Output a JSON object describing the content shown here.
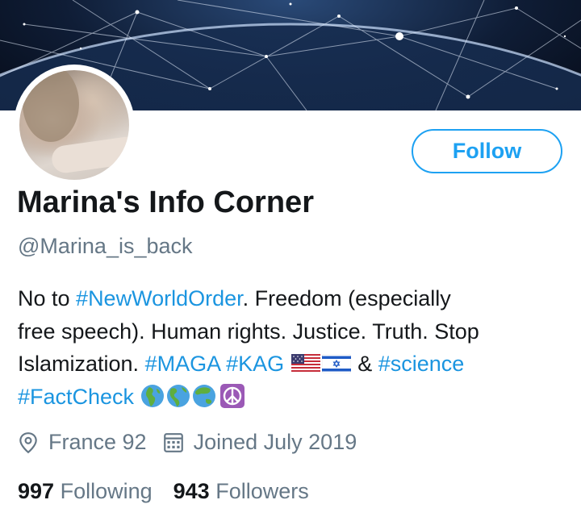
{
  "profile": {
    "display_name": "Marina's Info Corner",
    "handle": "@Marina_is_back",
    "follow_label": "Follow"
  },
  "bio": {
    "line1_text": "No to ",
    "line1_hashtag": "#NewWorldOrder",
    "line1_rest": ". Freedom (especially",
    "line2": "free speech). Human rights. Justice. Truth. Stop",
    "line3_text": "Islamization. ",
    "line3_hashtag1": "#MAGA",
    "line3_hashtag2": "#KAG",
    "line3_amp": " & ",
    "line3_hashtag3": "#science",
    "line4_hashtag": "#FactCheck",
    "emoji": [
      "us-flag-icon",
      "israel-flag-icon",
      "globe-europe-africa-icon",
      "globe-americas-icon",
      "globe-asia-australia-icon",
      "peace-symbol-icon"
    ]
  },
  "meta": {
    "location": "France 92",
    "joined": "Joined July 2019",
    "location_icon": "location-pin-icon",
    "calendar_icon": "calendar-icon"
  },
  "stats": {
    "following_count": "997",
    "following_label": "Following",
    "followers_count": "943",
    "followers_label": "Followers"
  },
  "colors": {
    "accent": "#1da1f2",
    "link": "#1b95e0",
    "text_primary": "#14171a",
    "text_secondary": "#657786",
    "peace_bg": "#9b59b6"
  }
}
